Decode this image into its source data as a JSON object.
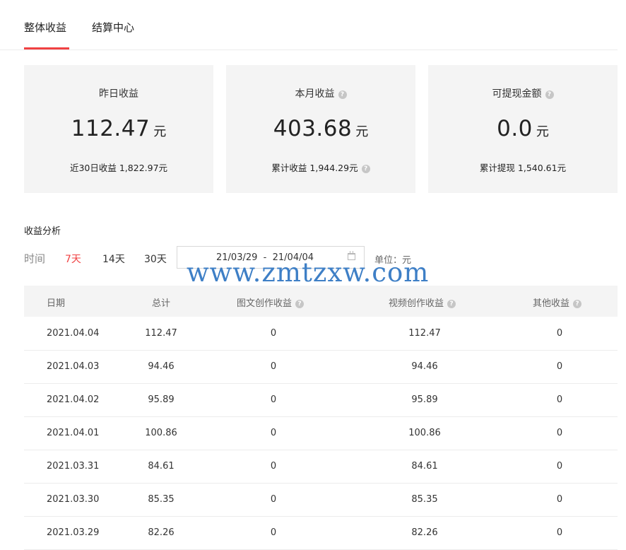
{
  "tabs": [
    {
      "label": "整体收益",
      "active": true
    },
    {
      "label": "结算中心",
      "active": false
    }
  ],
  "colors": {
    "accent": "#f04142",
    "card_bg": "#f4f4f4",
    "watermark": "#3e7fc6"
  },
  "cards": [
    {
      "title": "昨日收益",
      "value": "112.47",
      "unit": "元",
      "sub_label": "近30日收益",
      "sub_value": "1,822.97元",
      "has_help": false,
      "sub_help": false
    },
    {
      "title": "本月收益",
      "value": "403.68",
      "unit": "元",
      "sub_label": "累计收益",
      "sub_value": "1,944.29元",
      "has_help": true,
      "sub_help": true
    },
    {
      "title": "可提现金额",
      "value": "0.0",
      "unit": "元",
      "sub_label": "累计提现",
      "sub_value": "1,540.61元",
      "has_help": true,
      "sub_help": false
    }
  ],
  "analysis": {
    "title": "收益分析",
    "time_label": "时间",
    "ranges": [
      {
        "label": "7天",
        "active": true
      },
      {
        "label": "14天",
        "active": false
      },
      {
        "label": "30天",
        "active": false
      }
    ],
    "date_start": "21/03/29",
    "date_sep": "-",
    "date_end": "21/04/04",
    "unit_label": "单位：元"
  },
  "watermark": "www.zmtzxw.com",
  "table": {
    "headers": [
      {
        "label": "日期",
        "help": false
      },
      {
        "label": "总计",
        "help": false
      },
      {
        "label": "图文创作收益",
        "help": true
      },
      {
        "label": "视频创作收益",
        "help": true
      },
      {
        "label": "其他收益",
        "help": true
      }
    ],
    "rows": [
      [
        "2021.04.04",
        "112.47",
        "0",
        "112.47",
        "0"
      ],
      [
        "2021.04.03",
        "94.46",
        "0",
        "94.46",
        "0"
      ],
      [
        "2021.04.02",
        "95.89",
        "0",
        "95.89",
        "0"
      ],
      [
        "2021.04.01",
        "100.86",
        "0",
        "100.86",
        "0"
      ],
      [
        "2021.03.31",
        "84.61",
        "0",
        "84.61",
        "0"
      ],
      [
        "2021.03.30",
        "85.35",
        "0",
        "85.35",
        "0"
      ],
      [
        "2021.03.29",
        "82.26",
        "0",
        "82.26",
        "0"
      ]
    ]
  }
}
